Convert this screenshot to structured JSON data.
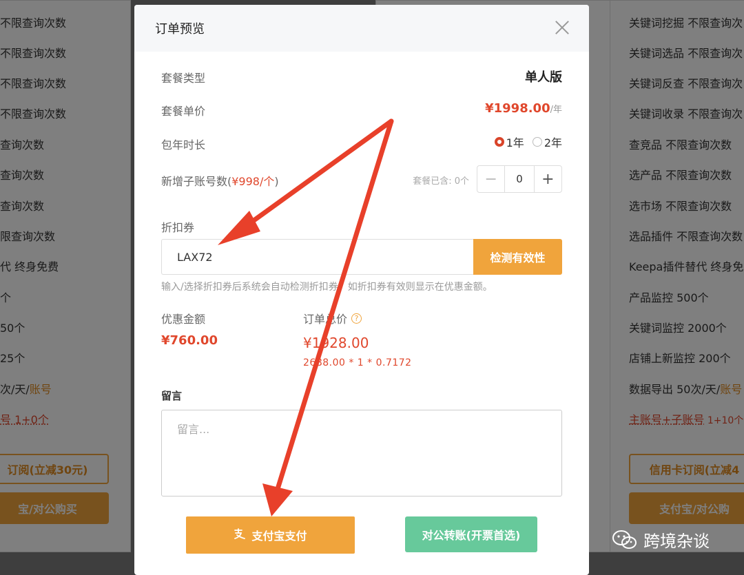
{
  "background": {
    "left_lines": [
      "不限查询次数",
      "不限查询次数",
      "不限查询次数",
      "不限查询次数",
      "查询次数",
      "查询次数",
      "查询次数",
      "限查询次数",
      "代 终身免费",
      "个",
      "50个",
      " 25个",
      "次/天/",
      "号 1+0个"
    ],
    "left_hl_suffix": "账号",
    "left_btn_outline": "订阅(立减30元)",
    "left_btn_fill": "宝/对公购买",
    "right_lines": [
      "关键词挖掘 不限查询次",
      "关键词选品 不限查询次",
      "关键词反查 不限查询次",
      "关键词收录 不限查询次",
      "查竞品 不限查询次数",
      "选产品 不限查询次数",
      "选市场 不限查询次数",
      "选品插件 不限查询次数",
      "Keepa插件替代 终身免",
      "产品监控 500个",
      "关键词监控 2000个",
      "店铺上新监控 200个",
      "数据导出 50次/天/"
    ],
    "right_hl_suffix": "账号",
    "right_account": "主账号+子账号",
    "right_account_count": " 1+10个",
    "right_btn_outline": "信用卡订阅(立减4",
    "right_btn_fill": "支付宝/对公购"
  },
  "modal": {
    "title": "订单预览",
    "plan_type_label": "套餐类型",
    "plan_type_value": "单人版",
    "unit_price_label": "套餐单价",
    "unit_price_value": "¥1998.00",
    "unit_price_unit": "/年",
    "duration_label": "包年时长",
    "duration_options": [
      "1年",
      "2年"
    ],
    "duration_selected": "1年",
    "sub_accounts_label": "新增子账号数(",
    "sub_accounts_price": "¥998/个",
    "sub_accounts_close": ")",
    "plan_includes": "套餐已含: 0个",
    "stepper_value": "0",
    "coupon_label": "折扣券",
    "coupon_value": "LAX72",
    "coupon_check_button": "检测有效性",
    "coupon_hint": "输入/选择折扣券后系统会自动检测折扣券，如折扣券有效则显示在优惠金额。",
    "discount_label": "优惠金额",
    "discount_value": "¥760.00",
    "total_label": "订单总价",
    "total_value": "¥1928.00",
    "total_formula": "2688.00 * 1 * 0.7172",
    "message_label": "留言",
    "message_placeholder": "留言...",
    "alipay_button": "支付宝支付",
    "transfer_button": "对公转账(开票首选)"
  },
  "watermark": {
    "text": "跨境杂谈"
  },
  "colors": {
    "accent": "#f0a43c",
    "price_red": "#e0472c",
    "green": "#67c99b",
    "arrow_red": "#e8402a"
  }
}
